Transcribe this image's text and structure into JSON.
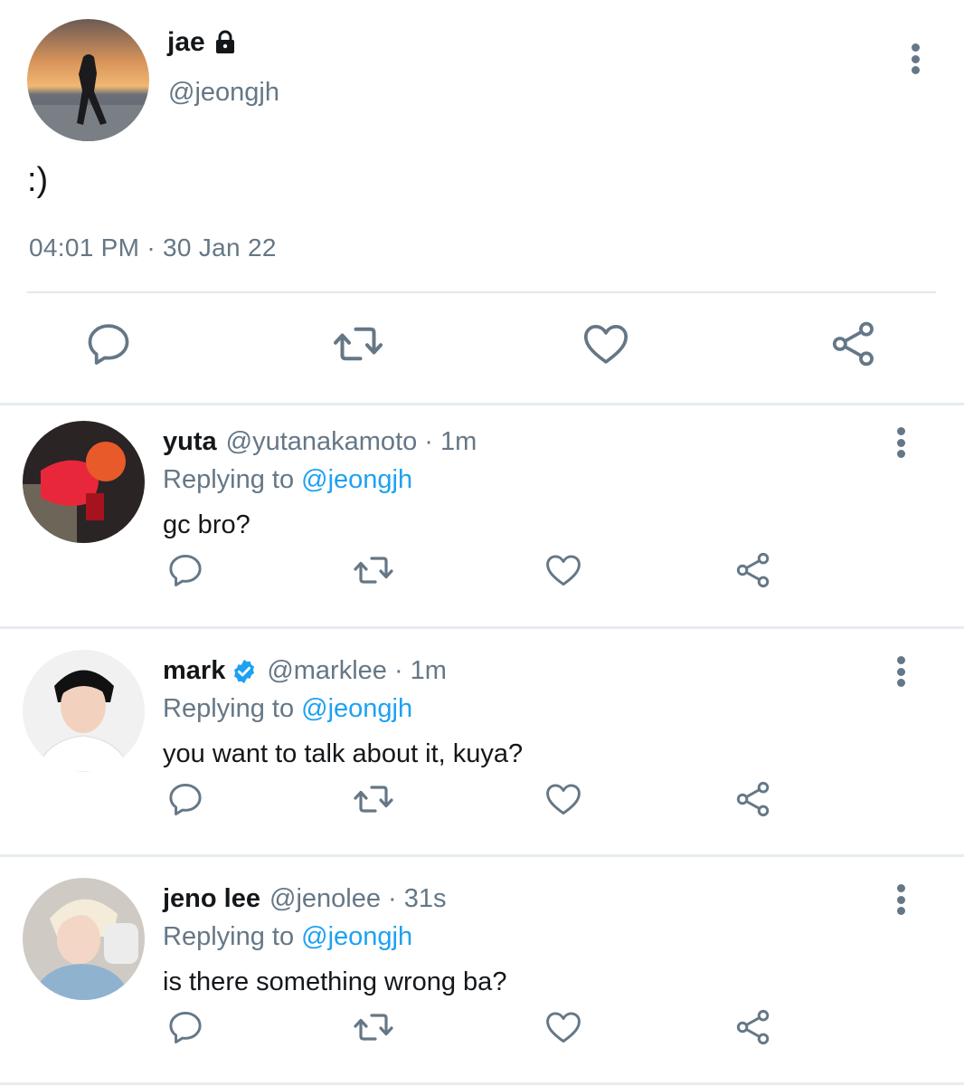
{
  "main_tweet": {
    "name": "jae",
    "handle": "@jeongjh",
    "text": ":)",
    "timestamp": "04:01 PM · 30 Jan 22",
    "protected": true
  },
  "replies": [
    {
      "name": "yuta",
      "meta": "@yutanakamoto · 1m",
      "replying_prefix": "Replying to ",
      "replying_to": "@jeongjh",
      "text": "gc bro?",
      "verified": false
    },
    {
      "name": "mark",
      "meta": "@marklee · 1m",
      "replying_prefix": "Replying to ",
      "replying_to": "@jeongjh",
      "text": "you want to talk about it, kuya?",
      "verified": true
    },
    {
      "name": "jeno lee",
      "meta": "@jenolee · 31s",
      "replying_prefix": "Replying to ",
      "replying_to": "@jeongjh",
      "text": "is there something wrong ba?",
      "verified": false
    }
  ],
  "icons": {
    "reply": "reply-icon",
    "retweet": "retweet-icon",
    "like": "heart-icon",
    "share": "share-icon",
    "menu": "more-vertical-icon",
    "lock": "lock-icon",
    "verified": "verified-badge-icon"
  },
  "colors": {
    "text_primary": "#14171a",
    "text_secondary": "#657786",
    "accent": "#1da1f2",
    "icon": "#657786",
    "divider": "#e6ecf0"
  }
}
